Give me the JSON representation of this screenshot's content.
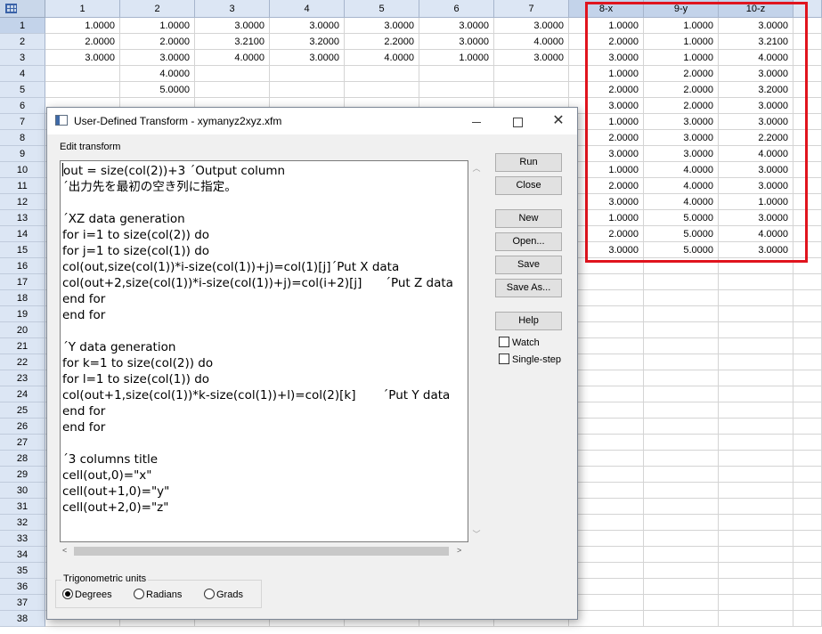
{
  "sheet": {
    "columns": [
      "1",
      "2",
      "3",
      "4",
      "5",
      "6",
      "7",
      "8-x",
      "9-y",
      "10-z"
    ],
    "rows": [
      "1",
      "2",
      "3",
      "4",
      "5",
      "6",
      "7",
      "8",
      "9",
      "10",
      "11",
      "12",
      "13",
      "14",
      "15",
      "16",
      "17",
      "18",
      "19",
      "20",
      "21",
      "22",
      "23",
      "24",
      "25",
      "26",
      "27",
      "28",
      "29",
      "30",
      "31",
      "32",
      "33",
      "34",
      "35",
      "36",
      "37",
      "38"
    ],
    "cells": [
      [
        "1.0000",
        "1.0000",
        "3.0000",
        "3.0000",
        "3.0000",
        "3.0000",
        "3.0000",
        "1.0000",
        "1.0000",
        "3.0000"
      ],
      [
        "2.0000",
        "2.0000",
        "3.2100",
        "3.2000",
        "2.2000",
        "3.0000",
        "4.0000",
        "2.0000",
        "1.0000",
        "3.2100"
      ],
      [
        "3.0000",
        "3.0000",
        "4.0000",
        "3.0000",
        "4.0000",
        "1.0000",
        "3.0000",
        "3.0000",
        "1.0000",
        "4.0000"
      ],
      [
        "",
        "4.0000",
        "",
        "",
        "",
        "",
        "",
        "1.0000",
        "2.0000",
        "3.0000"
      ],
      [
        "",
        "5.0000",
        "",
        "",
        "",
        "",
        "",
        "2.0000",
        "2.0000",
        "3.2000"
      ],
      [
        "",
        "",
        "",
        "",
        "",
        "",
        "",
        "3.0000",
        "2.0000",
        "3.0000"
      ],
      [
        "",
        "",
        "",
        "",
        "",
        "",
        "",
        "1.0000",
        "3.0000",
        "3.0000"
      ],
      [
        "",
        "",
        "",
        "",
        "",
        "",
        "",
        "2.0000",
        "3.0000",
        "2.2000"
      ],
      [
        "",
        "",
        "",
        "",
        "",
        "",
        "",
        "3.0000",
        "3.0000",
        "4.0000"
      ],
      [
        "",
        "",
        "",
        "",
        "",
        "",
        "",
        "1.0000",
        "4.0000",
        "3.0000"
      ],
      [
        "",
        "",
        "",
        "",
        "",
        "",
        "",
        "2.0000",
        "4.0000",
        "3.0000"
      ],
      [
        "",
        "",
        "",
        "",
        "",
        "",
        "",
        "3.0000",
        "4.0000",
        "1.0000"
      ],
      [
        "",
        "",
        "",
        "",
        "",
        "",
        "",
        "1.0000",
        "5.0000",
        "3.0000"
      ],
      [
        "",
        "",
        "",
        "",
        "",
        "",
        "",
        "2.0000",
        "5.0000",
        "4.0000"
      ],
      [
        "",
        "",
        "",
        "",
        "",
        "",
        "",
        "3.0000",
        "5.0000",
        "3.0000"
      ]
    ],
    "highlight_color": "#e0141e"
  },
  "dialog": {
    "title": "User-Defined Transform - xymanyz2xyz.xfm",
    "edit_label": "Edit transform",
    "code_lines": [
      "out = size(col(2))+3 ´Output column",
      "´出力先を最初の空き列に指定。",
      "",
      "´XZ data generation",
      "for i=1 to size(col(2)) do",
      "for j=1 to size(col(1)) do",
      "col(out,size(col(1))*i-size(col(1))+j)=col(1)[j]´Put X data",
      "col(out+2,size(col(1))*i-size(col(1))+j)=col(i+2)[j]      ´Put Z data",
      "end for",
      "end for",
      "",
      "´Y data generation",
      "for k=1 to size(col(2)) do",
      "for l=1 to size(col(1)) do",
      "col(out+1,size(col(1))*k-size(col(1))+l)=col(2)[k]       ´Put Y data",
      "end for",
      "end for",
      "",
      "´3 columns title",
      "cell(out,0)=\"x\"",
      "cell(out+1,0)=\"y\"",
      "cell(out+2,0)=\"z\""
    ],
    "buttons": {
      "run": "Run",
      "close": "Close",
      "new": "New",
      "open": "Open...",
      "save": "Save",
      "save_as": "Save As...",
      "help": "Help"
    },
    "checkboxes": {
      "watch": "Watch",
      "single_step": "Single-step"
    },
    "trig": {
      "label": "Trigonometric units",
      "options": [
        "Degrees",
        "Radians",
        "Grads"
      ],
      "selected": "Degrees"
    }
  }
}
